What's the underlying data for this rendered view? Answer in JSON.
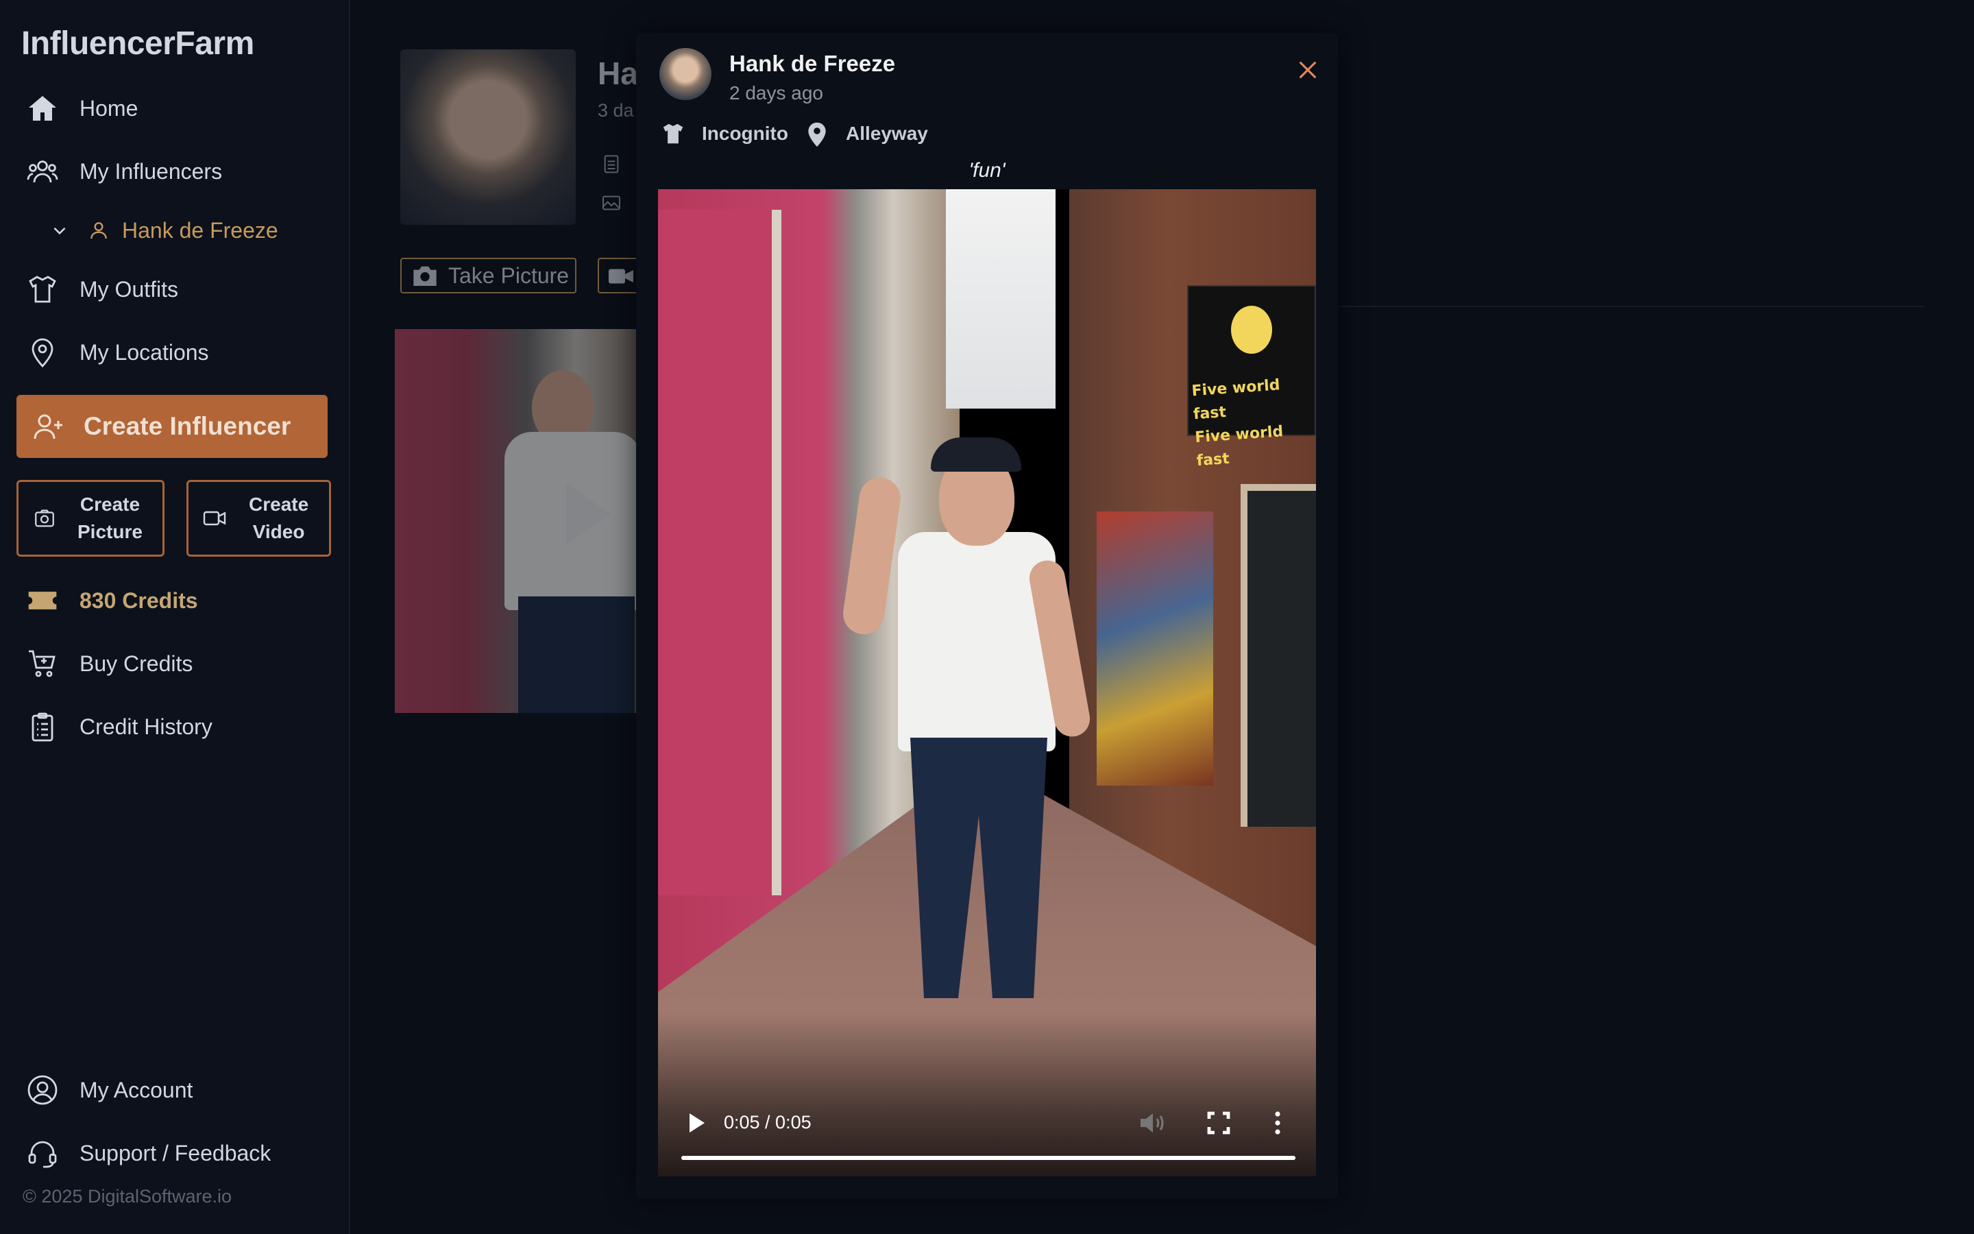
{
  "app": {
    "brand": "InfluencerFarm"
  },
  "sidebar": {
    "items": [
      {
        "label": "Home",
        "icon": "home-icon"
      },
      {
        "label": "My Influencers",
        "icon": "users-icon"
      },
      {
        "label": "My Outfits",
        "icon": "shirt-icon"
      },
      {
        "label": "My Locations",
        "icon": "map-pin-icon"
      }
    ],
    "sub_item": {
      "label": "Hank de Freeze",
      "icon": "user-icon"
    },
    "create_influencer": "Create Influencer",
    "create_picture": {
      "line1": "Create",
      "line2": "Picture"
    },
    "create_video": {
      "line1": "Create",
      "line2": "Video"
    },
    "credits": "830 Credits",
    "buy_credits": "Buy Credits",
    "credit_history": "Credit History",
    "my_account": "My Account",
    "support": "Support / Feedback",
    "copyright": "© 2025 DigitalSoftware.io"
  },
  "profile": {
    "name_partial": "Ha",
    "time_partial": "3 da",
    "take_picture": "Take Picture"
  },
  "modal": {
    "name": "Hank de Freeze",
    "time": "2 days ago",
    "outfit": "Incognito",
    "location": "Alleyway",
    "caption": "'fun'",
    "sign_line1": "Five world fast",
    "sign_line2": "Five world fast",
    "video": {
      "time": "0:05 / 0:05",
      "progress": 1.0
    }
  },
  "colors": {
    "accent": "#b26536",
    "accent_text": "#c89a5a",
    "credits": "#c5a672",
    "background": "#0a0e17",
    "sidebar": "#0c111c"
  }
}
